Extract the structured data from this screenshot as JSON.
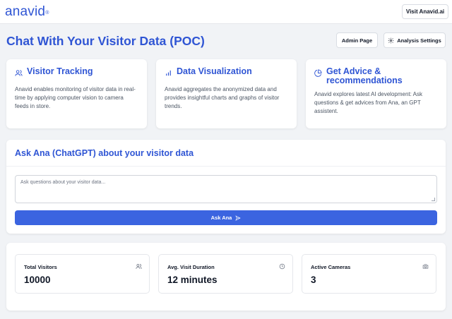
{
  "header": {
    "logo_text": "anavid",
    "logo_mark": "®",
    "visit_button": "Visit Anavid.ai"
  },
  "page": {
    "title": "Chat With Your Visitor Data (POC)",
    "admin_button": "Admin Page",
    "settings_button": "Analysis Settings",
    "settings_icon": "gear-icon"
  },
  "features": [
    {
      "icon": "users-icon",
      "title": "Visitor Tracking",
      "body": "Anavid enables monitoring of visitor data in real-time by applying computer vision to camera feeds in store."
    },
    {
      "icon": "bar-chart-icon",
      "title": "Data Visualization",
      "body": "Anavid aggregates the anonymized data and provides insightful charts and graphs of visitor trends."
    },
    {
      "icon": "pie-chart-icon",
      "title": "Get Advice & recommendations",
      "body": "Anavid explores latest AI development: Ask questions & get advices from Ana, an GPT assistent."
    }
  ],
  "ask": {
    "title": "Ask Ana (ChatGPT) about your visitor data",
    "placeholder": "Ask questions about your visitor data...",
    "button": "Ask Ana",
    "button_icon": "send-icon"
  },
  "stats": [
    {
      "label": "Total Visitors",
      "value": "10000",
      "icon": "users-icon"
    },
    {
      "label": "Avg. Visit Duration",
      "value": "12 minutes",
      "icon": "clock-icon"
    },
    {
      "label": "Active Cameras",
      "value": "3",
      "icon": "camera-icon"
    }
  ],
  "colors": {
    "accent": "#2f55d4",
    "button_primary": "#3b64e0",
    "background": "#f1f3f6"
  }
}
